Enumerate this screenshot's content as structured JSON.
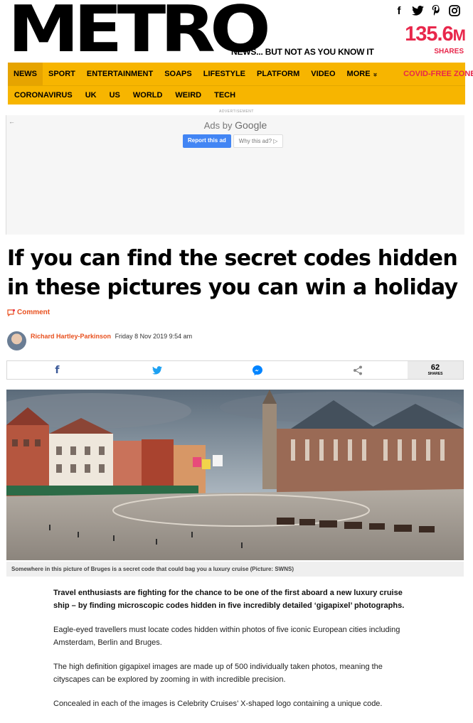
{
  "header": {
    "logo": "METRO",
    "tagline": "NEWS... BUT NOT AS YOU KNOW IT",
    "shares_number": "135.6",
    "shares_unit": "M",
    "shares_label": "SHARES",
    "social_icons": [
      "facebook-icon",
      "twitter-icon",
      "pinterest-icon",
      "instagram-icon"
    ]
  },
  "nav": {
    "primary": [
      "NEWS",
      "SPORT",
      "ENTERTAINMENT",
      "SOAPS",
      "LIFESTYLE",
      "PLATFORM",
      "VIDEO",
      "MORE"
    ],
    "more_glyph": "»",
    "covid": "COVID-FREE ZONE",
    "secondary": [
      "CORONAVIRUS",
      "UK",
      "US",
      "WORLD",
      "WEIRD",
      "TECH"
    ]
  },
  "ad": {
    "label": "ADVERTISEMENT",
    "ads_by": "Ads by",
    "google": "Google",
    "report": "Report this ad",
    "why": "Why this ad?"
  },
  "article": {
    "headline": "If you can find the secret codes hidden in these pictures you can win a holiday",
    "comment": "Comment",
    "author": "Richard Hartley-Parkinson",
    "date": "Friday 8 Nov 2019 9:54 am",
    "share_count": "62",
    "share_label": "SHARES",
    "caption": "Somewhere in this picture of Bruges is a secret code that could bag you a luxury cruise (Picture: SWNS)",
    "lead": "Travel enthusiasts are fighting for the chance to be one of the first aboard a new luxury cruise ship – by finding microscopic codes hidden in five incredibly detailed ‘gigapixel’ photographs.",
    "paragraphs": [
      "Eagle-eyed travellers must locate codes hidden within photos of five iconic European cities including Amsterdam, Berlin and Bruges.",
      "The high definition gigapixel images are made up of 500 individually taken photos, meaning the cityscapes can be explored by zooming in with incredible precision.",
      "Concealed in each of the images is Celebrity Cruises’ X-shaped logo containing a unique code."
    ]
  },
  "colors": {
    "nav_yellow": "#f7b500",
    "brand_red": "#e8274b",
    "author_orange": "#e8501e"
  }
}
